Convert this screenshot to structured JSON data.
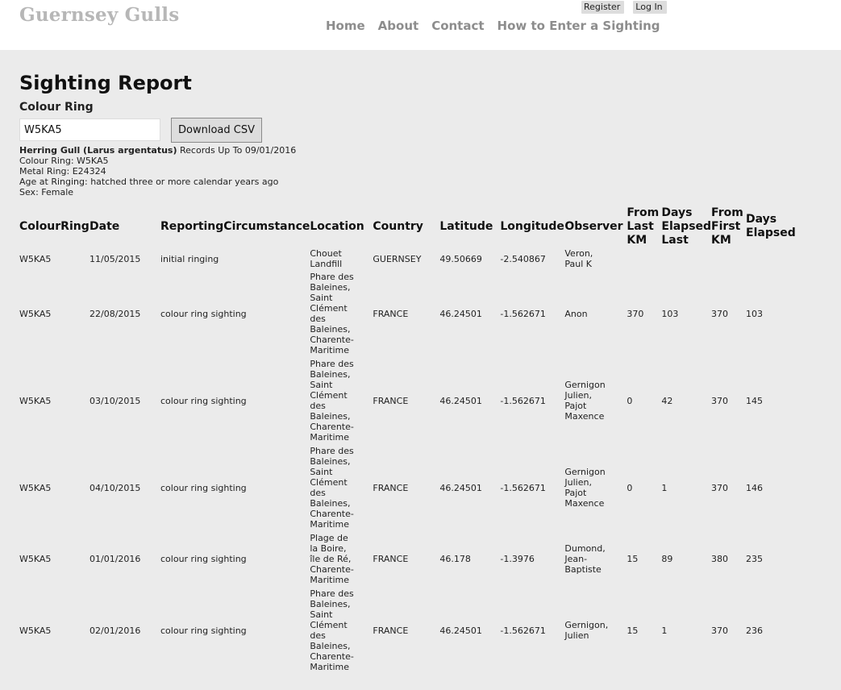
{
  "header": {
    "site_title": "Guernsey Gulls",
    "auth": {
      "register": "Register",
      "login": "Log In"
    },
    "nav": [
      "Home",
      "About",
      "Contact",
      "How to Enter a Sighting"
    ]
  },
  "page": {
    "title": "Sighting Report",
    "ring_label": "Colour Ring",
    "ring_value": "W5KA5",
    "csv_button": "Download CSV"
  },
  "bird": {
    "species": "Herring Gull (Larus argentatus)",
    "records_note": " Records Up To 09/01/2016",
    "colour_ring": "Colour Ring: W5KA5",
    "metal_ring": "Metal Ring: E24324",
    "age": "Age at Ringing: hatched three or more calendar years ago",
    "sex": "Sex: Female"
  },
  "table": {
    "headers": [
      "ColourRing",
      "Date",
      "ReportingCircumstance",
      "Location",
      "Country",
      "Latitude",
      "Longitude",
      "Observer",
      "From Last KM",
      "Days Elapsed Last",
      "From First KM",
      "Days Elapsed"
    ],
    "rows": [
      [
        "W5KA5",
        "11/05/2015",
        "initial ringing",
        "Chouet Landfill",
        "GUERNSEY",
        "49.50669",
        "-2.540867",
        "Veron, Paul K",
        "",
        "",
        "",
        ""
      ],
      [
        "W5KA5",
        "22/08/2015",
        "colour ring sighting",
        "Phare des Baleines, Saint Clément des Baleines, Charente-Maritime",
        "FRANCE",
        "46.24501",
        "-1.562671",
        "Anon",
        "370",
        "103",
        "370",
        "103"
      ],
      [
        "W5KA5",
        "03/10/2015",
        "colour ring sighting",
        "Phare des Baleines, Saint Clément des Baleines, Charente-Maritime",
        "FRANCE",
        "46.24501",
        "-1.562671",
        "Gernigon Julien, Pajot Maxence",
        "0",
        "42",
        "370",
        "145"
      ],
      [
        "W5KA5",
        "04/10/2015",
        "colour ring sighting",
        "Phare des Baleines, Saint Clément des Baleines, Charente-Maritime",
        "FRANCE",
        "46.24501",
        "-1.562671",
        "Gernigon Julien, Pajot Maxence",
        "0",
        "1",
        "370",
        "146"
      ],
      [
        "W5KA5",
        "01/01/2016",
        "colour ring sighting",
        "Plage de la Boire, île de Ré, Charente-Maritime",
        "FRANCE",
        "46.178",
        "-1.3976",
        "Dumond, Jean-Baptiste",
        "15",
        "89",
        "380",
        "235"
      ],
      [
        "W5KA5",
        "02/01/2016",
        "colour ring sighting",
        "Phare des Baleines, Saint Clément des Baleines, Charente-Maritime",
        "FRANCE",
        "46.24501",
        "-1.562671",
        "Gernigon, Julien",
        "15",
        "1",
        "370",
        "236"
      ]
    ]
  }
}
